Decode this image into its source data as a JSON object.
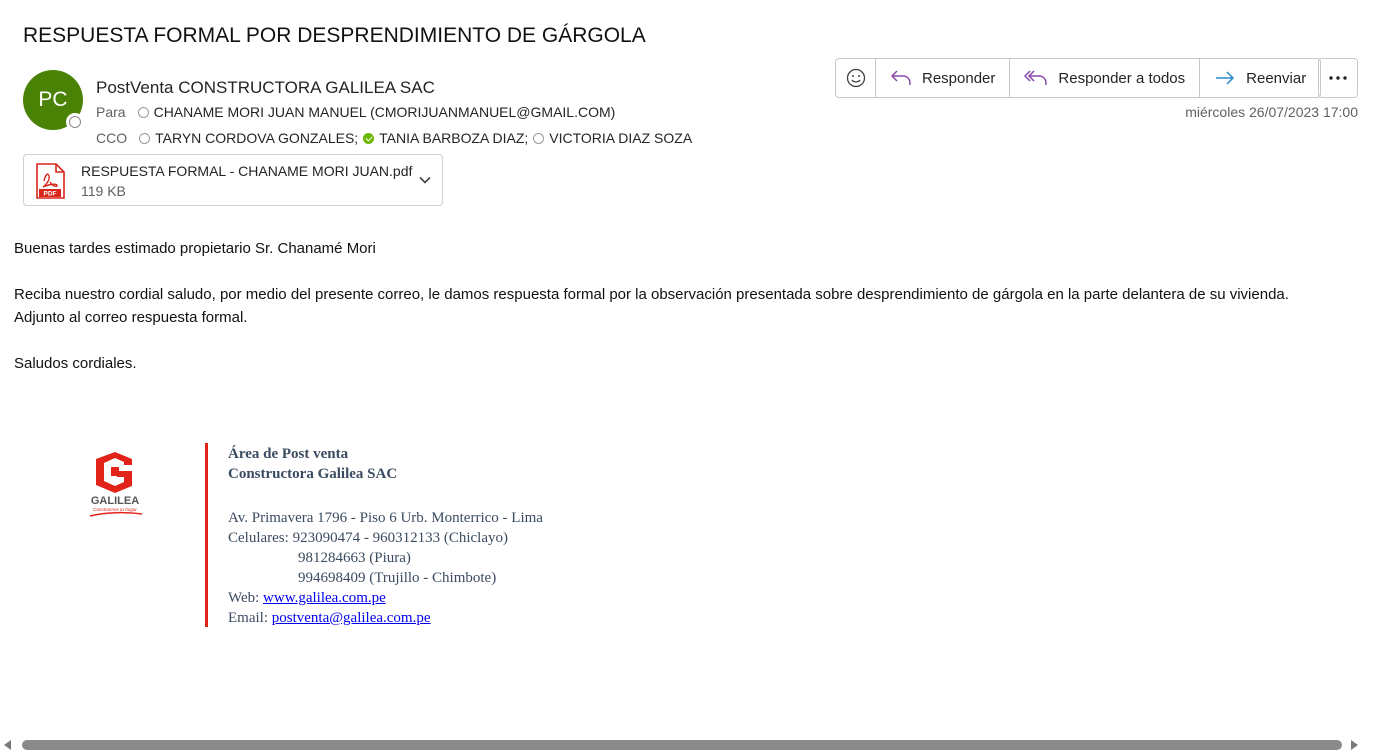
{
  "email": {
    "subject": "RESPUESTA FORMAL POR DESPRENDIMIENTO DE GÁRGOLA",
    "avatar_initials": "PC",
    "sender": "PostVenta CONSTRUCTORA GALILEA SAC",
    "to_label": "Para",
    "to": [
      "CHANAME MORI JUAN MANUEL (CMORIJUANMANUEL@GMAIL.COM)"
    ],
    "cco_label": "CCO",
    "cco": [
      "TARYN CORDOVA GONZALES;",
      "TANIA BARBOZA DIAZ;",
      "VICTORIA DIAZ SOZA"
    ],
    "date": "miércoles 26/07/2023 17:00"
  },
  "attachment": {
    "name": "RESPUESTA FORMAL - CHANAME MORI JUAN.pdf",
    "size": "119 KB",
    "icon_label": "PDF"
  },
  "actions": {
    "reply": "Responder",
    "reply_all": "Responder a todos",
    "forward": "Reenviar"
  },
  "body": {
    "greeting": "Buenas tardes estimado propietario Sr. Chanamé Mori",
    "paragraph1": "Reciba nuestro cordial saludo, por medio del presente correo, le damos respuesta formal por la observación presentada sobre desprendimiento de gárgola en la parte delantera de su vivienda.",
    "paragraph2": "Adjunto al correo respuesta formal.",
    "closing": "Saludos cordiales."
  },
  "signature": {
    "logo_text": "GALILEA",
    "logo_tagline": "Construimos tu hogar",
    "dept": "Área de Post venta",
    "company": "Constructora Galilea SAC",
    "address": "Av. Primavera 1796 - Piso 6 Urb. Monterrico - Lima",
    "phones_label": "Celulares:",
    "phone1": "923090474 - 960312133 (Chiclayo)",
    "phone2": "981284663 (Piura)",
    "phone3": "994698409 (Trujillo - Chimbote)",
    "web_label": "Web:",
    "web": "www.galilea.com.pe",
    "email_label": "Email:",
    "email": "postventa@galilea.com.pe"
  },
  "colors": {
    "avatar": "#498205",
    "accent_red": "#e2231a",
    "reply_icon": "#8a4ba8",
    "forward_icon": "#2b88c8"
  },
  "icons": [
    "emoji-icon",
    "reply-icon",
    "reply-all-icon",
    "forward-icon",
    "more-icon",
    "pdf-icon",
    "chevron-down-icon"
  ]
}
